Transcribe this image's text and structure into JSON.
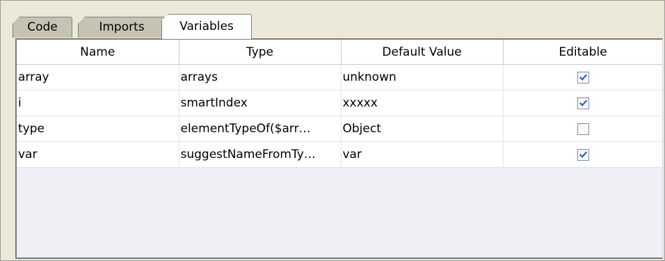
{
  "tabs": [
    {
      "label": "Code",
      "active": false
    },
    {
      "label": "Imports",
      "active": false
    },
    {
      "label": "Variables",
      "active": true
    }
  ],
  "table": {
    "columns": [
      "Name",
      "Type",
      "Default Value",
      "Editable"
    ],
    "rows": [
      {
        "name": "array",
        "type": "arrays",
        "default": "unknown",
        "editable": true
      },
      {
        "name": "i",
        "type": "smartIndex",
        "default": "xxxxx",
        "editable": true
      },
      {
        "name": "type",
        "type": "elementTypeOf($arr…",
        "default": "Object",
        "editable": false
      },
      {
        "name": "var",
        "type": "suggestNameFromTy…",
        "default": "var",
        "editable": true
      }
    ]
  },
  "colors": {
    "panel_bg": "#ece9d8",
    "inactive_tab": "#c6c3b2",
    "checkmark": "#2a5ec9"
  }
}
